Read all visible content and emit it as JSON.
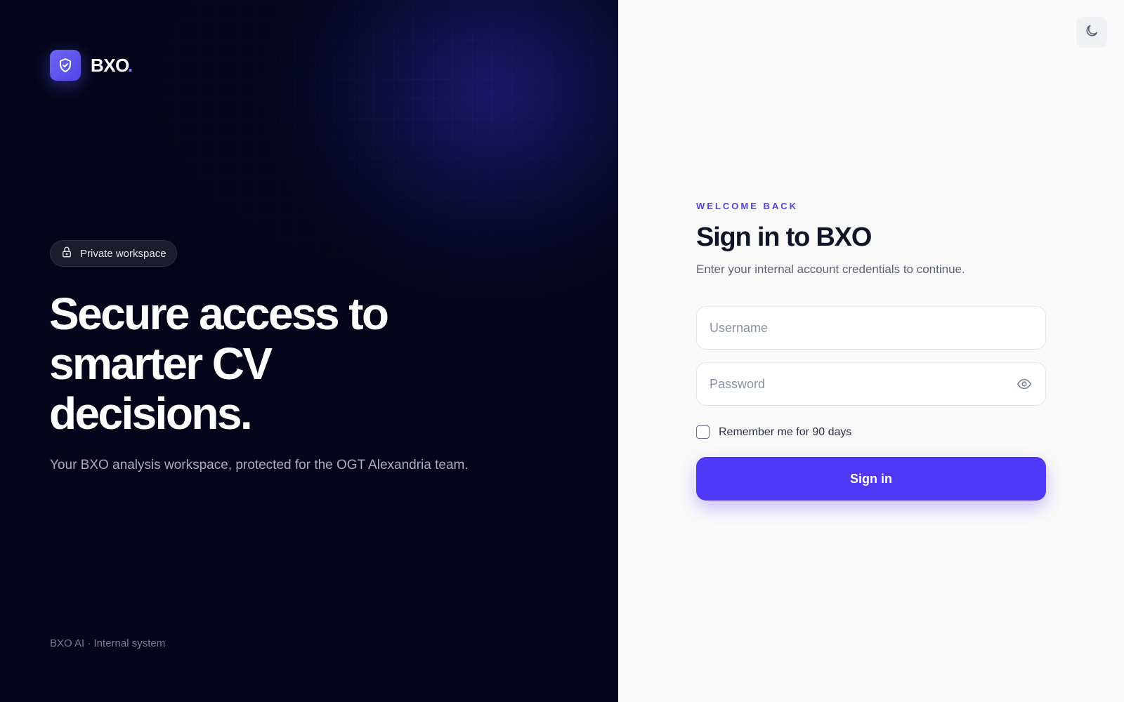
{
  "brand": {
    "name": "BXO",
    "dot": ".",
    "logo_icon": "shield-check-icon",
    "accent_color": "#4f46e5"
  },
  "left": {
    "badge_icon": "lock-icon",
    "badge_label": "Private workspace",
    "hero_lines": [
      "Secure access to",
      "smarter CV",
      "decisions."
    ],
    "subtitle": "Your BXO analysis workspace, protected for the OGT Alexandria team.",
    "footer": "BXO AI · Internal system"
  },
  "right": {
    "theme_toggle_icon": "moon-icon",
    "eyebrow": "WELCOME BACK",
    "title": "Sign in to BXO",
    "description": "Enter your internal account credentials to continue.",
    "username": {
      "placeholder": "Username",
      "value": ""
    },
    "password": {
      "placeholder": "Password",
      "value": "",
      "toggle_icon": "eye-icon"
    },
    "remember_label": "Remember me for 90 days",
    "remember_checked": false,
    "submit_label": "Sign in",
    "button_color": "#4f38f6"
  }
}
